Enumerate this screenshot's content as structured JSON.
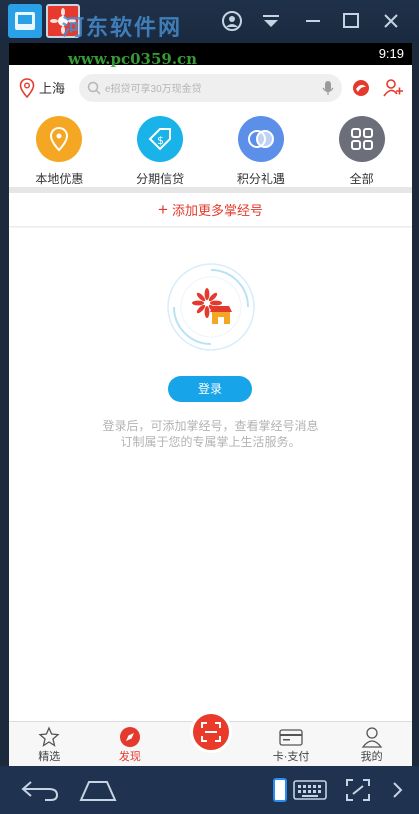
{
  "emulator": {
    "watermark": "河东软件网",
    "watermark_url": "www.pc0359.cn"
  },
  "status": {
    "time": "9:19"
  },
  "topbar": {
    "location": "上海",
    "search_placeholder": "e招贷可享30万现金贷"
  },
  "quick_items": [
    {
      "label": "本地优惠",
      "color": "#f5a623",
      "icon": "location-pin-icon"
    },
    {
      "label": "分期信贷",
      "color": "#19b3ea",
      "icon": "dollar-tag-icon"
    },
    {
      "label": "积分礼遇",
      "color": "#5b8fe8",
      "icon": "overlap-circles-icon"
    },
    {
      "label": "全部",
      "color": "#6c6f7a",
      "icon": "grid-icon"
    }
  ],
  "add_row": {
    "plus": "+",
    "label": "添加更多掌经号"
  },
  "main": {
    "login_label": "登录",
    "hint_line1": "登录后，可添加掌经号，查看掌经号消息",
    "hint_line2": "订制属于您的专属掌上生活服务。"
  },
  "nav": {
    "items": [
      {
        "label": "精选"
      },
      {
        "label": "发现"
      },
      {
        "label": "卡·支付"
      },
      {
        "label": "我的"
      }
    ],
    "active_color": "#e43a2e"
  }
}
